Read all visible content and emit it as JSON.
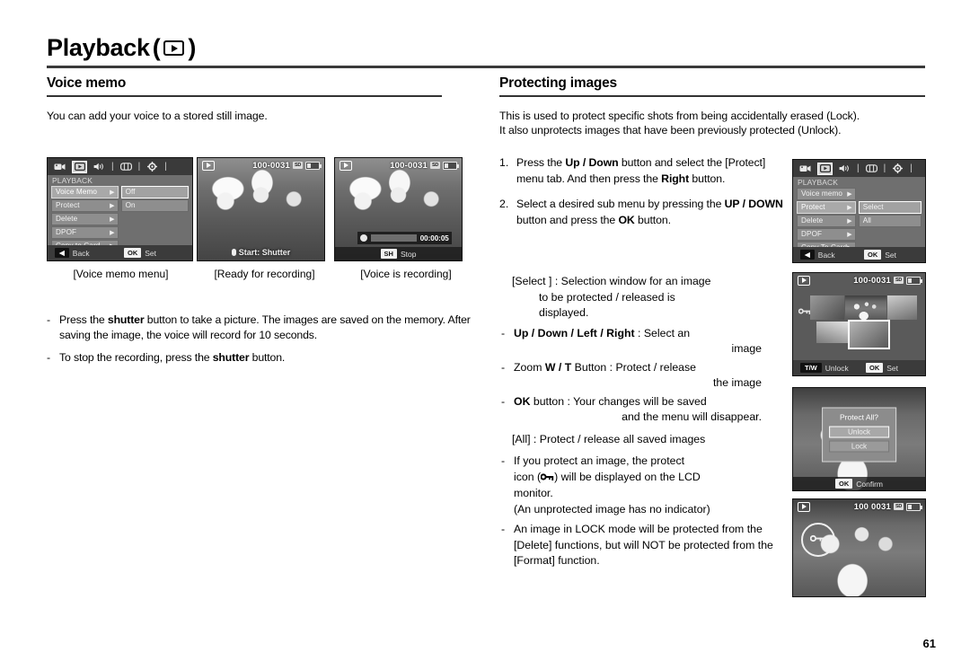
{
  "header": {
    "title": "Playback",
    "play_icon": "playback-icon"
  },
  "left": {
    "section_title": "Voice memo",
    "intro": "You can add your voice to a stored still image.",
    "menu_screen": {
      "icons": [
        "camera-icon",
        "playback-icon",
        "sound-icon",
        "display-icon",
        "setup-icon"
      ],
      "selected_icon_index": 1,
      "mode_label": "PLAYBACK",
      "rows": [
        {
          "label": "Voice Memo",
          "highlighted": true
        },
        {
          "label": "Protect",
          "highlighted": false
        },
        {
          "label": "Delete",
          "highlighted": false
        },
        {
          "label": "DPOF",
          "highlighted": false
        },
        {
          "label": "Copy to Card",
          "highlighted": false
        }
      ],
      "submenu": [
        {
          "label": "Off",
          "highlighted": true
        },
        {
          "label": "On",
          "highlighted": false
        }
      ],
      "footer": {
        "back_key": "◀",
        "back_label": "Back",
        "ok_key": "OK",
        "ok_label": "Set"
      }
    },
    "ready_screen": {
      "file_no": "100-0031",
      "sd_icon": "sd-card-icon",
      "battery_icon": "battery-icon",
      "hint": "Start: Shutter"
    },
    "recording_screen": {
      "file_no": "100-0031",
      "sd_icon": "sd-card-icon",
      "battery_icon": "battery-icon",
      "elapsed": "00:00:05",
      "stop_key": "SH",
      "stop_label": "Stop"
    },
    "captions": [
      "[Voice memo menu]",
      "[Ready for recording]",
      "[Voice is recording]"
    ],
    "bullets": [
      {
        "dash": "-",
        "parts": [
          {
            "t": "Press the ",
            "b": false
          },
          {
            "t": "shutter",
            "b": true
          },
          {
            "t": " button to take a picture. The images are saved on the memory. After saving the image, the voice will record for 10 seconds.",
            "b": false
          }
        ]
      },
      {
        "dash": "-",
        "parts": [
          {
            "t": "To stop the recording, press the ",
            "b": false
          },
          {
            "t": "shutter",
            "b": true
          },
          {
            "t": " button.",
            "b": false
          }
        ]
      }
    ]
  },
  "right": {
    "section_title": "Protecting images",
    "intro_line1": "This is used to protect specific shots from being accidentally erased (Lock).",
    "intro_line2": "It also unprotects images that have been previously protected (Unlock).",
    "steps": [
      {
        "num": "1.",
        "parts": [
          {
            "t": "Press the ",
            "b": false
          },
          {
            "t": "Up / Down",
            "b": true
          },
          {
            "t": " button and select the [Protect] menu tab. And then press the ",
            "b": false
          },
          {
            "t": "Right",
            "b": true
          },
          {
            "t": " button.",
            "b": false
          }
        ]
      },
      {
        "num": "2.",
        "parts": [
          {
            "t": "Select a desired sub menu by pressing the ",
            "b": false
          },
          {
            "t": "UP / DOWN",
            "b": true
          },
          {
            "t": " button and press the ",
            "b": false
          },
          {
            "t": "OK",
            "b": true
          },
          {
            "t": " button.",
            "b": false
          }
        ]
      }
    ],
    "select_head_line1": "[Select ] : Selection window for an image",
    "select_head_line2": "to be protected / released is",
    "select_head_line3": "displayed.",
    "select_bullets": [
      {
        "dash": "-",
        "bold": "Up / Down / Left / Right",
        "rest": " : Select an",
        "cont": "image"
      },
      {
        "dash": "-",
        "pre": "Zoom ",
        "bold": "W / T",
        "rest": " Button : Protect / release",
        "cont": "the image"
      },
      {
        "dash": "-",
        "bold": "OK",
        "rest": " button : Your changes will be saved",
        "cont": "and the menu will disappear."
      }
    ],
    "all_line": "[All] : Protect / release all saved images",
    "notes": [
      {
        "dash": "-",
        "line1_a": "If you protect an image, the protect",
        "line2_a": "icon (",
        "lock_icon": "lock-key-icon",
        "line2_b": ") will be displayed on the LCD",
        "line3": "monitor.",
        "line4": "(An unprotected image has no indicator)"
      },
      {
        "dash": "-",
        "line1_a": "An image in LOCK mode will be protected from the [Delete] functions, but will NOT be protected from the [Format] function."
      }
    ],
    "protect_menu_screen": {
      "icons": [
        "camera-icon",
        "playback-icon",
        "sound-icon",
        "display-icon",
        "setup-icon"
      ],
      "selected_icon_index": 1,
      "mode_label": "PLAYBACK",
      "rows": [
        {
          "label": "Voice memo",
          "highlighted": false
        },
        {
          "label": "Protect",
          "highlighted": true
        },
        {
          "label": "Delete",
          "highlighted": false
        },
        {
          "label": "DPOF",
          "highlighted": false
        },
        {
          "label": "Copy To Card",
          "highlighted": false
        }
      ],
      "submenu": [
        {
          "label": "Select",
          "highlighted": true
        },
        {
          "label": "All",
          "highlighted": false
        }
      ],
      "footer": {
        "back_key": "◀",
        "back_label": "Back",
        "ok_key": "OK",
        "ok_label": "Set"
      }
    },
    "thumbnail_screen": {
      "file_no": "100-0031",
      "sd_icon": "sd-card-icon",
      "battery_icon": "battery-icon",
      "lock_icon": "lock-key-icon",
      "tw_key": "T/W",
      "tw_label": "Unlock",
      "ok_key": "OK",
      "ok_label": "Set"
    },
    "protect_all_screen": {
      "dialog_title": "Protect All?",
      "options": [
        {
          "label": "Unlock",
          "highlighted": true
        },
        {
          "label": "Lock",
          "highlighted": false
        }
      ],
      "ok_key": "OK",
      "ok_label": "Confirm"
    },
    "locked_image_screen": {
      "file_no": "100 0031",
      "sd_icon": "sd-card-icon",
      "battery_icon": "battery-icon",
      "lock_icon": "lock-key-icon"
    }
  },
  "page_number": "61",
  "colors": {
    "rule": "#3a3a3a",
    "lcd_bg": "#5d5d5d",
    "menu_bg": "#6f6f6f"
  }
}
